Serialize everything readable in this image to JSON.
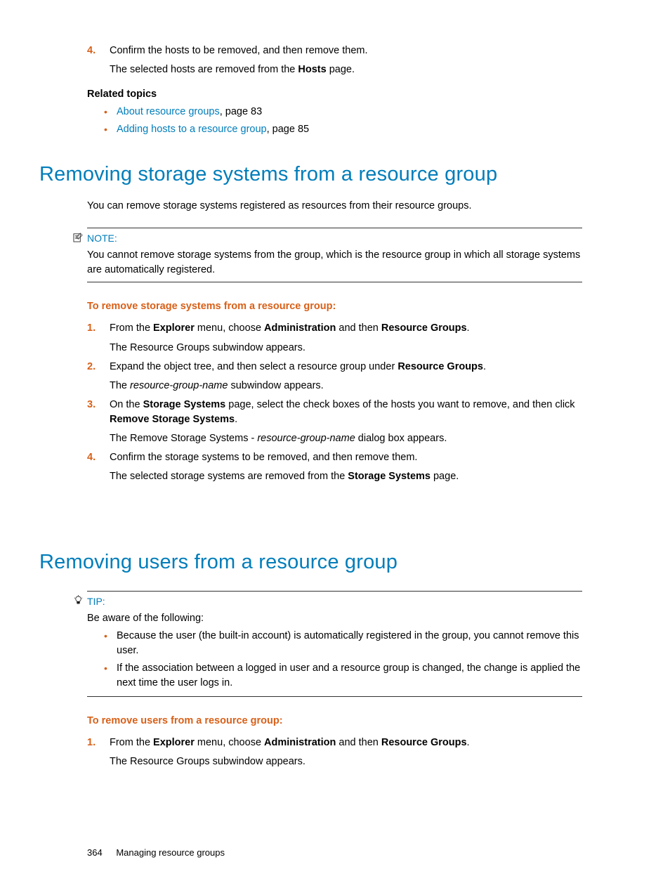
{
  "top": {
    "step4": {
      "num": "4.",
      "text_a": "Confirm the hosts to be removed, and then remove them.",
      "text_b1": "The selected hosts are removed from the ",
      "text_b2": "Hosts",
      "text_b3": " page."
    },
    "rel_heading": "Related topics",
    "rel1_link": "About resource groups",
    "rel1_suffix": ", page 83",
    "rel2_link": "Adding hosts to a resource group",
    "rel2_suffix": ", page 85"
  },
  "sec1": {
    "heading": "Removing storage systems from a resource group",
    "intro": "You can remove storage systems registered as resources from their resource groups.",
    "note_label": "NOTE:",
    "note_body": "You cannot remove storage systems from the                                       group, which is the resource group in which all storage systems are automatically registered.",
    "proc_heading": "To remove storage systems from a resource group:",
    "steps": [
      {
        "num": "1.",
        "line1_parts": [
          "From the ",
          "Explorer",
          " menu, choose ",
          "Administration",
          " and then ",
          "Resource Groups",
          "."
        ],
        "line2": "The Resource Groups subwindow appears."
      },
      {
        "num": "2.",
        "line1_parts": [
          "Expand the object tree, and then select a resource group under ",
          "Resource Groups",
          "."
        ],
        "line2_parts": [
          "The ",
          "resource-group-name",
          " subwindow appears."
        ]
      },
      {
        "num": "3.",
        "line1_parts": [
          "On the ",
          "Storage Systems",
          " page, select the check boxes of the hosts you want to remove, and then click ",
          "Remove Storage Systems",
          "."
        ],
        "line2_parts": [
          "The Remove Storage Systems - ",
          "resource-group-name",
          " dialog box appears."
        ]
      },
      {
        "num": "4.",
        "line1": "Confirm the storage systems to be removed, and then remove them.",
        "line2_parts": [
          "The selected storage systems are removed from the ",
          "Storage Systems",
          " page."
        ]
      }
    ]
  },
  "sec2": {
    "heading": "Removing users from a resource group",
    "tip_label": "TIP:",
    "tip_intro": "Be aware of the following:",
    "tip_items": [
      "Because the user              (the built-in account) is automatically registered in the                      group, you cannot remove this user.",
      "If the association between a logged in user and a resource group is changed, the change is applied the next time the user logs in."
    ],
    "proc_heading": "To remove users from a resource group:",
    "steps": [
      {
        "num": "1.",
        "line1_parts": [
          "From the ",
          "Explorer",
          " menu, choose ",
          "Administration",
          " and then ",
          "Resource Groups",
          "."
        ],
        "line2": "The Resource Groups subwindow appears."
      }
    ]
  },
  "footer": {
    "page": "364",
    "title": "Managing resource groups"
  }
}
